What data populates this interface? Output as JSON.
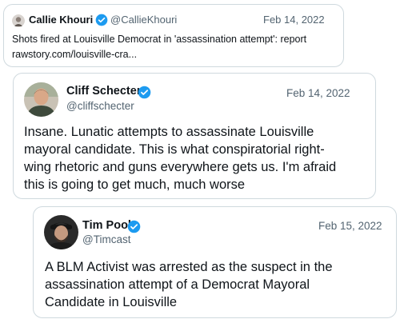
{
  "colors": {
    "verified": "#1d9bf0",
    "border": "#cfd9de",
    "secondary_text": "#536471"
  },
  "tweets": [
    {
      "name": "Callie Khouri",
      "handle": "@CallieKhouri",
      "date": "Feb 14, 2022",
      "lines": [
        "Shots fired at Louisville Democrat in 'assassination attempt': report",
        "rawstory.com/louisville-cra..."
      ]
    },
    {
      "name": "Cliff Schecter",
      "handle": "@cliffschecter",
      "date": "Feb 14, 2022",
      "lines": [
        "Insane. Lunatic attempts to assassinate Louisville",
        "mayoral candidate. This is what conspiratorial right-",
        "wing rhetoric and guns everywhere gets us. I'm afraid",
        "this is going to get much, much worse"
      ]
    },
    {
      "name": "Tim Pool",
      "handle": "@Timcast",
      "date": "Feb 15, 2022",
      "lines": [
        "A BLM Activist was arrested as the suspect in the",
        "assassination attempt of a Democrat Mayoral",
        "Candidate in Louisville"
      ]
    }
  ]
}
